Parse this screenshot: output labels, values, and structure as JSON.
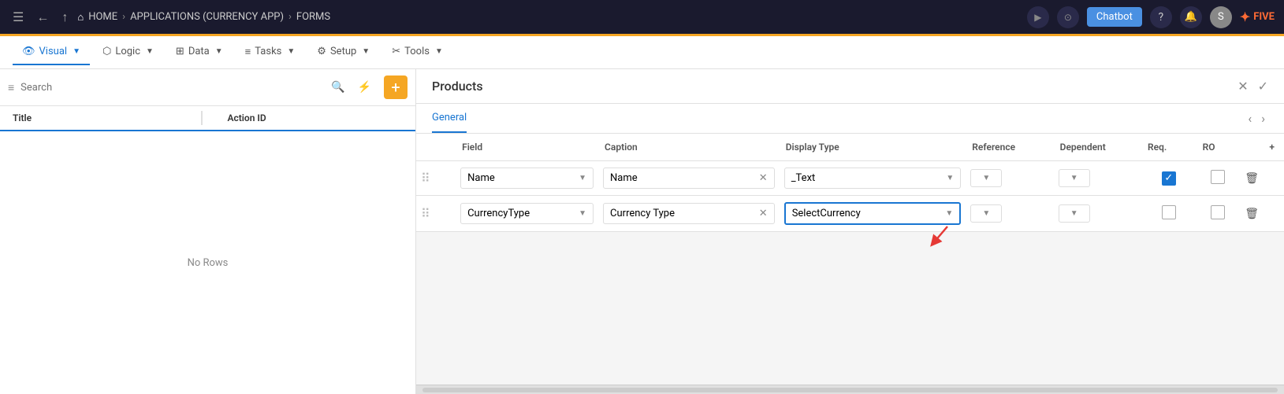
{
  "topnav": {
    "breadcrumbs": [
      "HOME",
      "APPLICATIONS (CURRENCY APP)",
      "FORMS"
    ],
    "chatbot_label": "Chatbot",
    "user_initial": "S"
  },
  "secnav": {
    "items": [
      {
        "label": "Visual",
        "active": true
      },
      {
        "label": "Logic",
        "active": false
      },
      {
        "label": "Data",
        "active": false
      },
      {
        "label": "Tasks",
        "active": false
      },
      {
        "label": "Setup",
        "active": false
      },
      {
        "label": "Tools",
        "active": false
      }
    ]
  },
  "sidebar": {
    "search_placeholder": "Search",
    "col_title": "Title",
    "col_action_id": "Action ID",
    "empty_text": "No Rows"
  },
  "panel": {
    "title": "Products",
    "tabs": [
      {
        "label": "General",
        "active": true
      }
    ],
    "table": {
      "headers": [
        "",
        "Field",
        "Caption",
        "Display Type",
        "Reference",
        "Dependent",
        "Req.",
        "RO",
        "+"
      ],
      "rows": [
        {
          "field": "Name",
          "caption": "Name",
          "display_type": "_Text",
          "reference": "",
          "dependent": "",
          "req": true,
          "ro": false
        },
        {
          "field": "CurrencyType",
          "caption": "Currency Type",
          "display_type": "SelectCurrency",
          "reference": "",
          "dependent": "",
          "req": false,
          "ro": false
        }
      ]
    }
  }
}
